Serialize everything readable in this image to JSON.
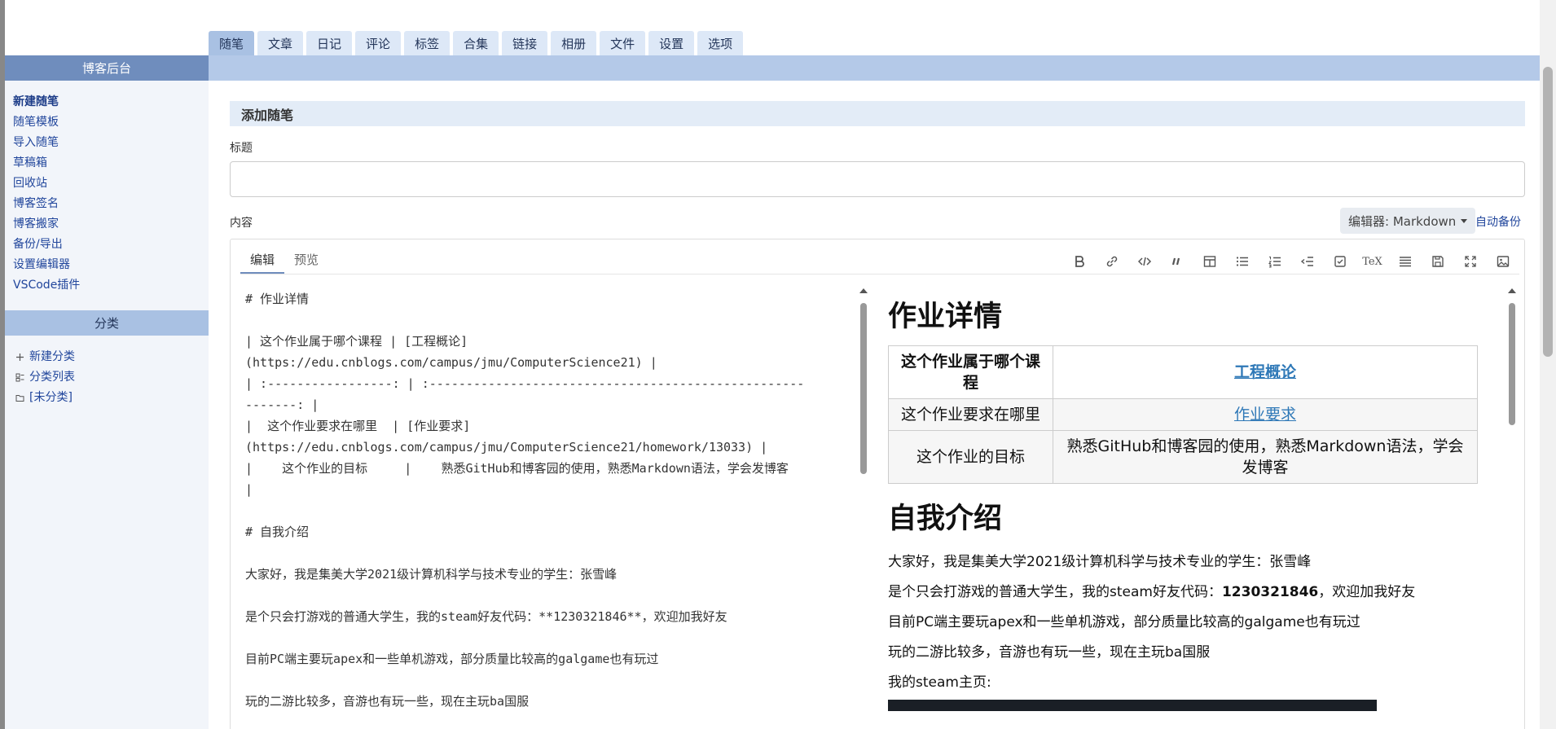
{
  "tabs": [
    "随笔",
    "文章",
    "日记",
    "评论",
    "标签",
    "合集",
    "链接",
    "相册",
    "文件",
    "设置",
    "选项"
  ],
  "sidebar": {
    "header": "博客后台",
    "items": [
      "新建随笔",
      "随笔模板",
      "导入随笔",
      "草稿箱",
      "回收站",
      "博客签名",
      "博客搬家",
      "备份/导出",
      "设置编辑器",
      "VSCode插件"
    ],
    "category_header": "分类",
    "categories": [
      {
        "icon": "plus-icon",
        "label": "新建分类"
      },
      {
        "icon": "list-icon",
        "label": "分类列表"
      },
      {
        "icon": "folder-icon",
        "label": "[未分类]"
      }
    ]
  },
  "main": {
    "section_title": "添加随笔",
    "title_label": "标题",
    "title_value": "",
    "content_label": "内容",
    "editor_select": "编辑器: Markdown",
    "autosave": "自动备份",
    "editor_tabs": [
      "编辑",
      "预览"
    ],
    "toolbar": [
      "bold-icon",
      "link-icon",
      "code-icon",
      "quote-icon",
      "table-icon",
      "bullet-list-icon",
      "numbered-list-icon",
      "outdent-icon",
      "checkbox-icon",
      "tex-icon",
      "align-icon",
      "save-icon",
      "fullscreen-icon",
      "image-icon"
    ],
    "toolbar_tex_label": "TeX"
  },
  "source_lines": [
    "# 作业详情",
    "",
    "| 这个作业属于哪个课程 | [工程概论]",
    "(https://edu.cnblogs.com/campus/jmu/ComputerScience21) |",
    "| :-----------------: | :---------------------------------------------------",
    "-------: |",
    "|  这个作业要求在哪里  | [作业要求]",
    "(https://edu.cnblogs.com/campus/jmu/ComputerScience21/homework/13033) |",
    "|    这个作业的目标     |    熟悉GitHub和博客园的使用，熟悉Markdown语法，学会发博客",
    "|",
    "",
    "# 自我介绍",
    "",
    "大家好，我是集美大学2021级计算机科学与技术专业的学生：张雪峰",
    "",
    "是个只会打游戏的普通大学生，我的steam好友代码：**1230321846**，欢迎加我好友",
    "",
    "目前PC端主要玩apex和一些单机游戏，部分质量比较高的galgame也有玩过",
    "",
    "玩的二游比较多，音游也有玩一些，现在主玩ba国服"
  ],
  "preview": {
    "h1_first": "作业详情",
    "table": [
      {
        "header": "这个作业属于哪个课程",
        "link": "工程概论",
        "bold": true
      },
      {
        "header": "这个作业要求在哪里",
        "link": "作业要求",
        "bold": false
      },
      {
        "header": "这个作业的目标",
        "text": "熟悉GitHub和博客园的使用，熟悉Markdown语法，学会发博客"
      }
    ],
    "h1_second": "自我介绍",
    "p1": "大家好，我是集美大学2021级计算机科学与技术专业的学生：张雪峰",
    "p2_before": "是个只会打游戏的普通大学生，我的steam好友代码：",
    "p2_bold": "1230321846",
    "p2_after": "，欢迎加我好友",
    "p3": "目前PC端主要玩apex和一些单机游戏，部分质量比较高的galgame也有玩过",
    "p4": "玩的二游比较多，音游也有玩一些，现在主玩ba国服",
    "p5": "我的steam主页:"
  }
}
